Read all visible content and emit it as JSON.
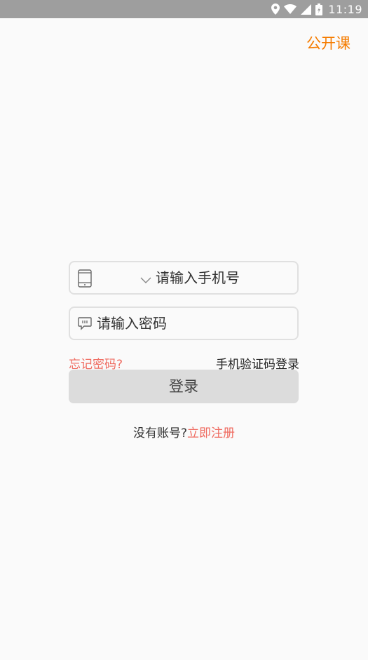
{
  "status_bar": {
    "time": "11:19",
    "icons": [
      "location-icon",
      "wifi-icon",
      "cell-signal-icon",
      "battery-icon"
    ]
  },
  "header": {
    "open_course_link": "公开课"
  },
  "login_form": {
    "phone_placeholder": "请输入手机号",
    "password_placeholder": "请输入密码",
    "forgot_password": "忘记密码?",
    "sms_login": "手机验证码登录",
    "login_button": "登录"
  },
  "register": {
    "prompt": "没有账号?",
    "link": "立即注册"
  },
  "colors": {
    "accent_orange": "#f57c00",
    "link_red": "#ef6b60",
    "button_gray": "#dcdcdc",
    "status_bar_gray": "#9e9e9e"
  }
}
